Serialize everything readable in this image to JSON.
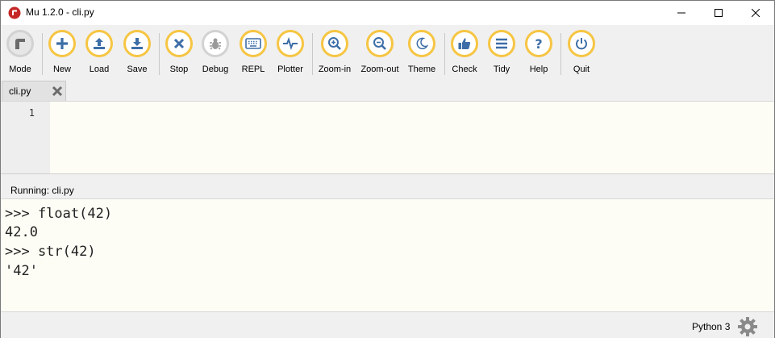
{
  "window": {
    "title": "Mu 1.2.0 - cli.py"
  },
  "toolbar": {
    "buttons": [
      {
        "id": "mode",
        "label": "Mode",
        "icon": "mode-icon"
      },
      {
        "id": "new",
        "label": "New",
        "icon": "plus-icon"
      },
      {
        "id": "load",
        "label": "Load",
        "icon": "upload-icon"
      },
      {
        "id": "save",
        "label": "Save",
        "icon": "download-icon"
      },
      {
        "id": "stop",
        "label": "Stop",
        "icon": "x-icon"
      },
      {
        "id": "debug",
        "label": "Debug",
        "icon": "bug-icon"
      },
      {
        "id": "repl",
        "label": "REPL",
        "icon": "keyboard-icon"
      },
      {
        "id": "plotter",
        "label": "Plotter",
        "icon": "pulse-icon"
      },
      {
        "id": "zoom_in",
        "label": "Zoom-in",
        "icon": "zoom-in-icon"
      },
      {
        "id": "zoom_out",
        "label": "Zoom-out",
        "icon": "zoom-out-icon"
      },
      {
        "id": "theme",
        "label": "Theme",
        "icon": "moon-icon"
      },
      {
        "id": "check",
        "label": "Check",
        "icon": "thumbs-up-icon"
      },
      {
        "id": "tidy",
        "label": "Tidy",
        "icon": "lines-icon"
      },
      {
        "id": "help",
        "label": "Help",
        "icon": "question-icon"
      },
      {
        "id": "quit",
        "label": "Quit",
        "icon": "power-icon"
      }
    ]
  },
  "tabs": [
    {
      "label": "cli.py",
      "active": true
    }
  ],
  "editor": {
    "line_numbers": [
      "1"
    ]
  },
  "repl": {
    "header": "Running: cli.py",
    "lines": [
      ">>> float(42)",
      "42.0",
      ">>> str(42)",
      "'42'"
    ]
  },
  "status": {
    "mode": "Python 3"
  },
  "colors": {
    "accent_ring": "#f6c543",
    "icon_blue": "#3d6ea7",
    "disabled_ring": "#d2d2d2",
    "editor_bg": "#fefdf5"
  }
}
